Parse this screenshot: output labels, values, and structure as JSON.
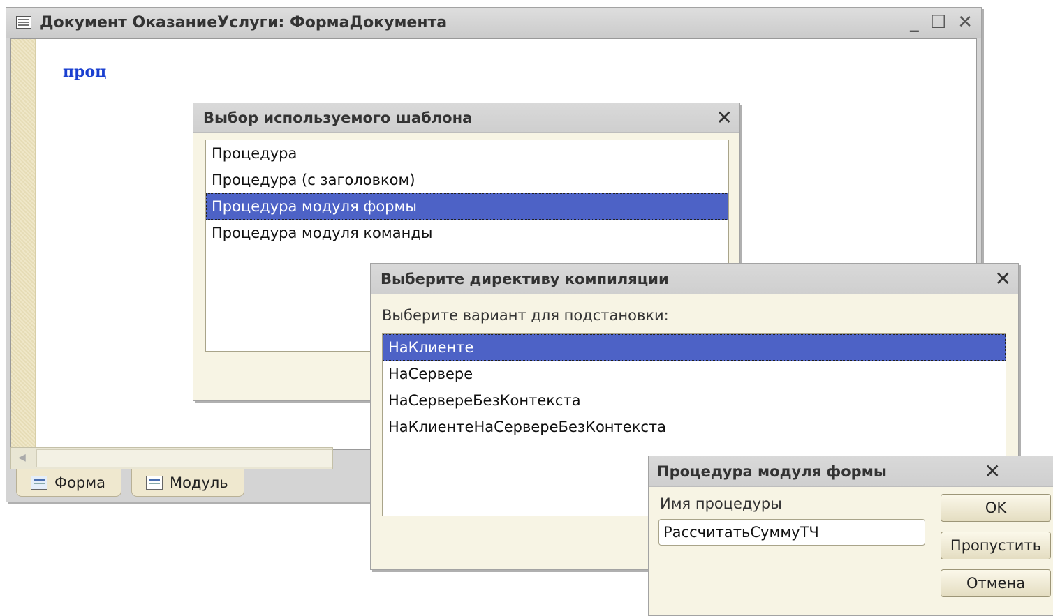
{
  "main_window": {
    "title": "Документ ОказаниеУслуги: ФормаДокумента",
    "code": "проц",
    "tabs": [
      {
        "label": "Форма"
      },
      {
        "label": "Модуль"
      }
    ]
  },
  "template_dialog": {
    "title": "Выбор используемого шаблона",
    "items": [
      {
        "label": "Процедура"
      },
      {
        "label": "Процедура (с заголовком)"
      },
      {
        "label": "Процедура модуля формы"
      },
      {
        "label": "Процедура модуля команды"
      }
    ],
    "selected_index": 2
  },
  "directive_dialog": {
    "title": "Выберите директиву компиляции",
    "prompt": "Выберите вариант для подстановки:",
    "items": [
      {
        "label": "НаКлиенте"
      },
      {
        "label": "НаСервере"
      },
      {
        "label": "НаСервереБезКонтекста"
      },
      {
        "label": "НаКлиентеНаСервереБезКонтекста"
      }
    ],
    "selected_index": 0
  },
  "procedure_dialog": {
    "title": "Процедура модуля формы",
    "field_label": "Имя процедуры",
    "field_value": "РассчитатьСуммуТЧ",
    "ok_label": "OK",
    "skip_label": "Пропустить",
    "cancel_label": "Отмена"
  },
  "colors": {
    "selection": "#4d62c6",
    "window_bg": "#f7f4e4",
    "code_text": "#1a3fd0"
  }
}
